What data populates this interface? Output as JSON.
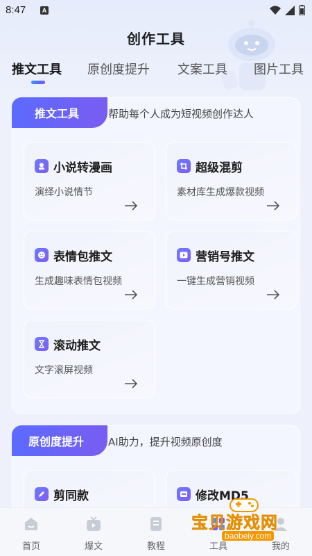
{
  "status_bar": {
    "time": "8:47",
    "notification_letter": "A"
  },
  "header": {
    "title": "创作工具"
  },
  "tabs": [
    {
      "label": "推文工具",
      "active": true
    },
    {
      "label": "原创度提升",
      "active": false
    },
    {
      "label": "文案工具",
      "active": false
    },
    {
      "label": "图片工具",
      "active": false
    }
  ],
  "sections": [
    {
      "badge": "推文工具",
      "subtitle": "帮助每个人成为短视频创作达人",
      "cards": [
        {
          "title": "小说转漫画",
          "desc": "演绎小说情节",
          "icon": "comic-icon"
        },
        {
          "title": "超级混剪",
          "desc": "素材库生成爆款视频",
          "icon": "crop-icon"
        },
        {
          "title": "表情包推文",
          "desc": "生成趣味表情包视频",
          "icon": "emoji-icon"
        },
        {
          "title": "营销号推文",
          "desc": "一键生成营销视频",
          "icon": "play-icon"
        },
        {
          "title": "滚动推文",
          "desc": "文字滚屏视频",
          "icon": "hourglass-icon"
        }
      ]
    },
    {
      "badge": "原创度提升",
      "subtitle": "AI助力，提升视频原创度",
      "cards": [
        {
          "title": "剪同款",
          "icon": "edit-icon"
        },
        {
          "title": "修改MD5",
          "icon": "md5-icon"
        }
      ]
    }
  ],
  "bottom_nav": [
    {
      "label": "首页",
      "icon": "home-icon"
    },
    {
      "label": "爆文",
      "icon": "tv-icon"
    },
    {
      "label": "教程",
      "icon": "book-icon"
    },
    {
      "label": "工具",
      "icon": "tools-icon"
    },
    {
      "label": "我的",
      "icon": "profile-icon"
    }
  ],
  "watermark": {
    "text": "宝贝游戏网",
    "url": "baobeiy.com"
  },
  "colors": {
    "accent": "#6a5cff",
    "badge_start": "#5b6bff",
    "badge_end": "#7a5cf0"
  }
}
